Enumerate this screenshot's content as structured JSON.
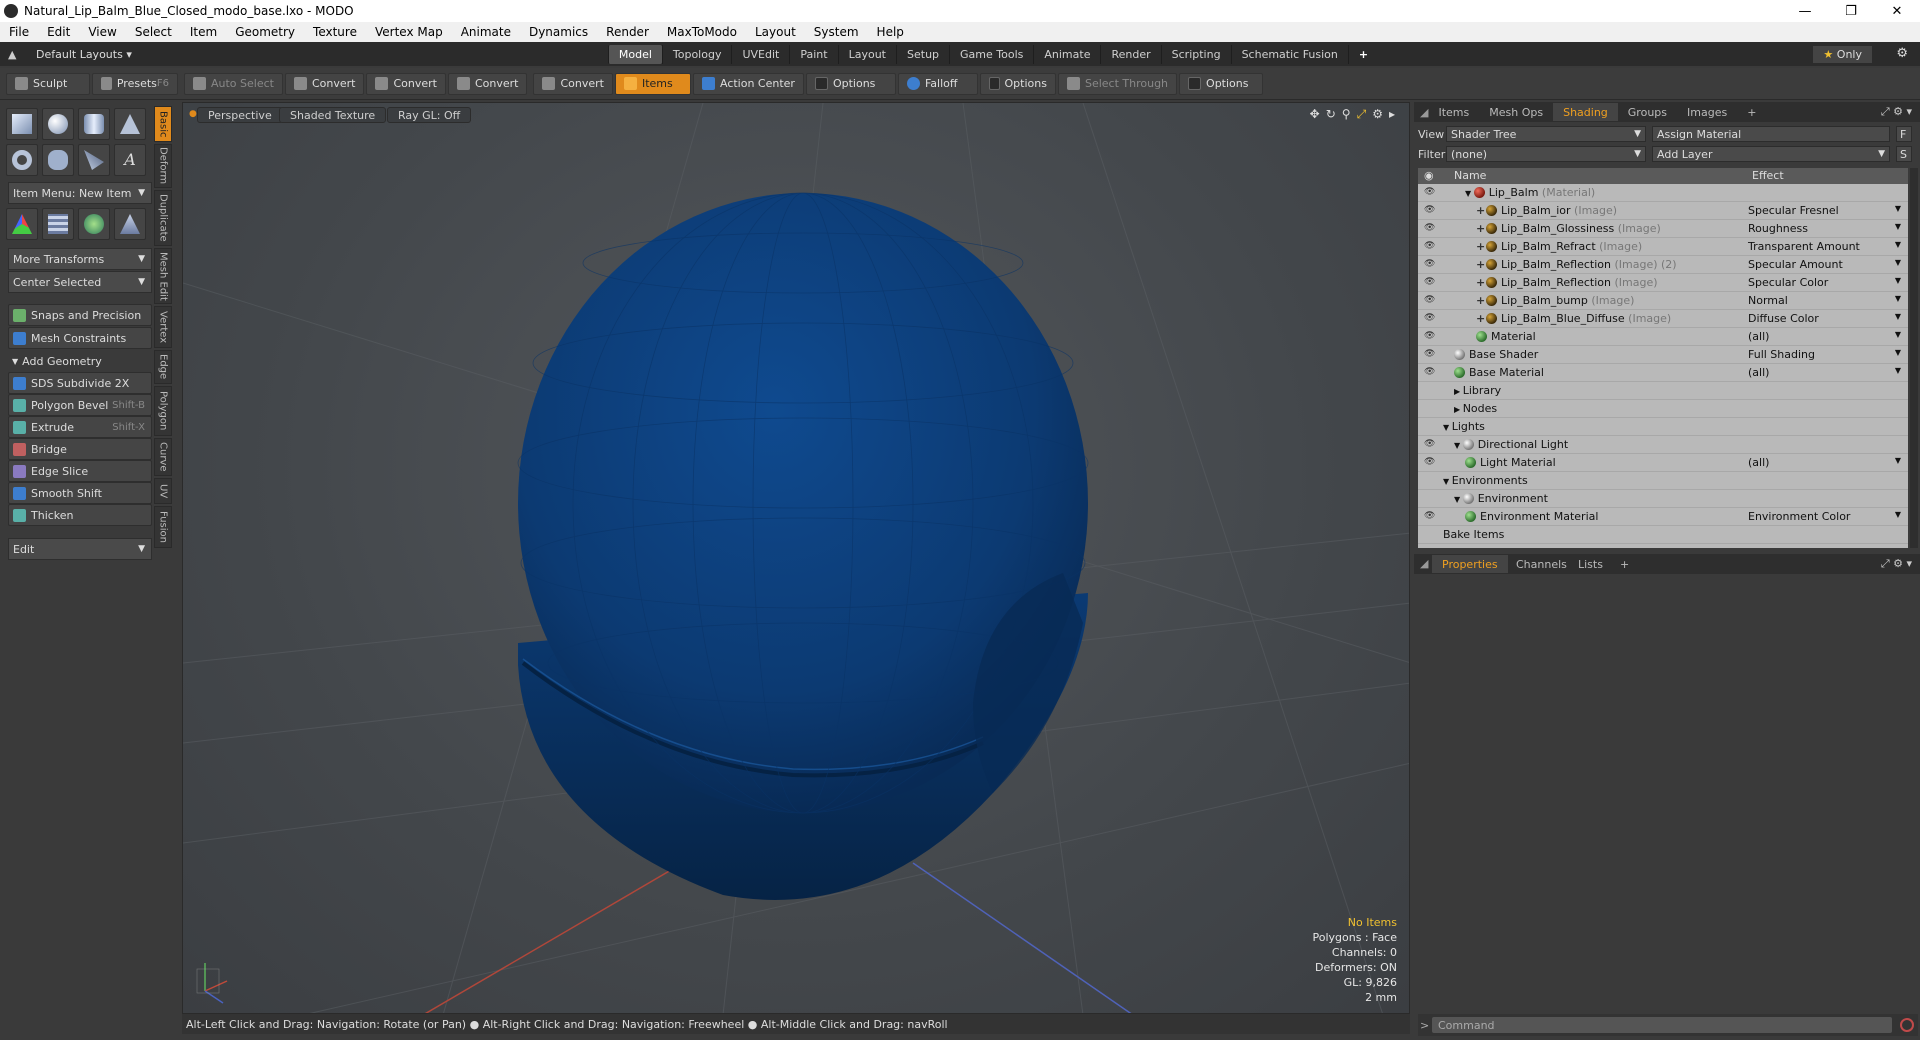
{
  "window": {
    "title": "Natural_Lip_Balm_Blue_Closed_modo_base.lxo - MODO"
  },
  "menu": [
    "File",
    "Edit",
    "View",
    "Select",
    "Item",
    "Geometry",
    "Texture",
    "Vertex Map",
    "Animate",
    "Dynamics",
    "Render",
    "MaxToModo",
    "Layout",
    "System",
    "Help"
  ],
  "layouts": {
    "selector": "Default Layouts",
    "tabs": [
      "Model",
      "Topology",
      "UVEdit",
      "Paint",
      "Layout",
      "Setup",
      "Game Tools",
      "Animate",
      "Render",
      "Scripting",
      "Schematic Fusion"
    ],
    "active": "Model",
    "only_label": "Only"
  },
  "toolbar": {
    "sculpt": "Sculpt",
    "presets": "Presets",
    "presets_key": "F6",
    "auto_select": "Auto Select",
    "convert1": "Convert",
    "convert2": "Convert",
    "convert3": "Convert",
    "convert4": "Convert",
    "items": "Items",
    "action_center": "Action Center",
    "options1": "Options",
    "falloff": "Falloff",
    "options2": "Options",
    "select_through": "Select Through",
    "options3": "Options"
  },
  "left": {
    "item_menu": "Item Menu: New Item",
    "more_transforms": "More Transforms",
    "center_selected": "Center Selected",
    "snaps": "Snaps and Precision",
    "mesh_constraints": "Mesh Constraints",
    "add_geometry": "Add Geometry",
    "tools": [
      {
        "label": "SDS Subdivide 2X",
        "key": ""
      },
      {
        "label": "Polygon Bevel",
        "key": "Shift-B"
      },
      {
        "label": "Extrude",
        "key": "Shift-X"
      },
      {
        "label": "Bridge",
        "key": ""
      },
      {
        "label": "Edge Slice",
        "key": ""
      },
      {
        "label": "Smooth Shift",
        "key": ""
      },
      {
        "label": "Thicken",
        "key": ""
      }
    ],
    "edit": "Edit",
    "vtabs": [
      "Basic",
      "Deform",
      "Duplicate",
      "Mesh Edit",
      "Vertex",
      "Edge",
      "Polygon",
      "Curve",
      "UV",
      "Fusion"
    ]
  },
  "viewport": {
    "view": "Perspective",
    "shading": "Shaded Texture",
    "raygl": "Ray GL: Off",
    "info": {
      "items": "No Items",
      "polygons": "Polygons : Face",
      "channels": "Channels: 0",
      "deformers": "Deformers: ON",
      "gl": "GL: 9,826",
      "scale": "2 mm"
    },
    "object_color": "#0d3d78"
  },
  "status": "Alt-Left Click and Drag: Navigation: Rotate (or Pan) ● Alt-Right Click and Drag: Navigation: Freewheel ● Alt-Middle Click and Drag: navRoll",
  "right": {
    "tabs": [
      "Items",
      "Mesh Ops",
      "Shading",
      "Groups",
      "Images"
    ],
    "active_tab": "Shading",
    "view_label": "View",
    "view_value": "Shader Tree",
    "assign_material": "Assign Material",
    "f_btn": "F",
    "filter_label": "Filter",
    "filter_value": "(none)",
    "add_layer": "Add Layer",
    "s_btn": "S",
    "col_name": "Name",
    "col_effect": "Effect",
    "tree": [
      {
        "name": "Lip_Balm",
        "sub": "(Material)",
        "effect": "",
        "icon": "red",
        "eye": true,
        "indent": 3,
        "arrow": "▼"
      },
      {
        "name": "Lip_Balm_ior",
        "sub": "(Image)",
        "effect": "Specular Fresnel",
        "icon": "img",
        "eye": true,
        "indent": 4,
        "plus": true
      },
      {
        "name": "Lip_Balm_Glossiness",
        "sub": "(Image)",
        "effect": "Roughness",
        "icon": "img",
        "eye": true,
        "indent": 4,
        "plus": true
      },
      {
        "name": "Lip_Balm_Refract",
        "sub": "(Image)",
        "effect": "Transparent Amount",
        "icon": "img",
        "eye": true,
        "indent": 4,
        "plus": true
      },
      {
        "name": "Lip_Balm_Reflection",
        "sub": "(Image) (2)",
        "effect": "Specular Amount",
        "icon": "img",
        "eye": true,
        "indent": 4,
        "plus": true
      },
      {
        "name": "Lip_Balm_Reflection",
        "sub": "(Image)",
        "effect": "Specular Color",
        "icon": "img",
        "eye": true,
        "indent": 4,
        "plus": true
      },
      {
        "name": "Lip_Balm_bump",
        "sub": "(Image)",
        "effect": "Normal",
        "icon": "img",
        "eye": true,
        "indent": 4,
        "plus": true
      },
      {
        "name": "Lip_Balm_Blue_Diffuse",
        "sub": "(Image)",
        "effect": "Diffuse Color",
        "icon": "img",
        "eye": true,
        "indent": 4,
        "plus": true
      },
      {
        "name": "Material",
        "sub": "",
        "effect": "(all)",
        "icon": "mat",
        "eye": true,
        "indent": 4
      },
      {
        "name": "Base Shader",
        "sub": "",
        "effect": "Full Shading",
        "icon": "shd",
        "eye": true,
        "indent": 2
      },
      {
        "name": "Base Material",
        "sub": "",
        "effect": "(all)",
        "icon": "mat",
        "eye": true,
        "indent": 2
      },
      {
        "name": "Library",
        "sub": "",
        "effect": "",
        "icon": "",
        "eye": false,
        "indent": 2,
        "arrow": "▶"
      },
      {
        "name": "Nodes",
        "sub": "",
        "effect": "",
        "icon": "",
        "eye": false,
        "indent": 2,
        "arrow": "▶"
      },
      {
        "name": "Lights",
        "sub": "",
        "effect": "",
        "icon": "",
        "eye": false,
        "indent": 1,
        "arrow": "▼"
      },
      {
        "name": "Directional Light",
        "sub": "",
        "effect": "",
        "icon": "shd",
        "eye": true,
        "indent": 2,
        "arrow": "▼"
      },
      {
        "name": "Light Material",
        "sub": "",
        "effect": "(all)",
        "icon": "mat",
        "eye": true,
        "indent": 3
      },
      {
        "name": "Environments",
        "sub": "",
        "effect": "",
        "icon": "",
        "eye": false,
        "indent": 1,
        "arrow": "▼"
      },
      {
        "name": "Environment",
        "sub": "",
        "effect": "",
        "icon": "shd",
        "eye": false,
        "indent": 2,
        "arrow": "▼"
      },
      {
        "name": "Environment Material",
        "sub": "",
        "effect": "Environment Color",
        "icon": "mat",
        "eye": true,
        "indent": 3
      },
      {
        "name": "Bake Items",
        "sub": "",
        "effect": "",
        "icon": "",
        "eye": false,
        "indent": 1
      }
    ],
    "prop_tabs": [
      "Properties",
      "Channels",
      "Lists"
    ],
    "command_placeholder": "Command"
  }
}
